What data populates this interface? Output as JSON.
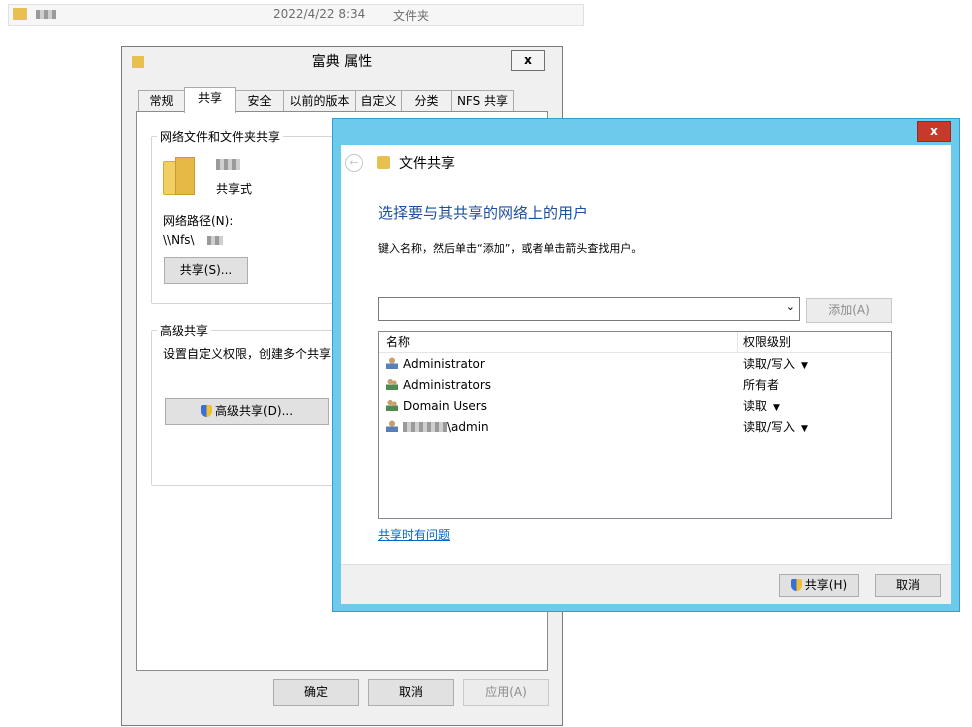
{
  "explorer": {
    "date": "2022/4/22 8:34",
    "type": "文件夹",
    "icon": "folder-icon"
  },
  "properties": {
    "title": "富典 属性",
    "close_label": "x",
    "tabs": [
      {
        "label": "常规"
      },
      {
        "label": "共享",
        "active": true
      },
      {
        "label": "安全"
      },
      {
        "label": "以前的版本"
      },
      {
        "label": "自定义"
      },
      {
        "label": "分类"
      },
      {
        "label": "NFS 共享"
      }
    ],
    "network_share": {
      "group_title": "网络文件和文件夹共享",
      "share_type": "共享式",
      "path_label": "网络路径(N):",
      "path_value": "\\\\Nfs\\",
      "share_button": "共享(S)..."
    },
    "advanced": {
      "group_title": "高级共享",
      "description": "设置自定义权限，创建多个共享",
      "button": "高级共享(D)..."
    },
    "footer": {
      "ok": "确定",
      "cancel": "取消",
      "apply": "应用(A)"
    }
  },
  "wizard": {
    "title": "文件共享",
    "close_label": "x",
    "heading": "选择要与其共享的网络上的用户",
    "instruction": "键入名称，然后单击“添加”，或者单击箭头查找用户。",
    "input_value": "",
    "add_button": "添加(A)",
    "columns": {
      "name": "名称",
      "permission": "权限级别"
    },
    "rows": [
      {
        "name": "Administrator",
        "permission": "读取/写入",
        "dropdown": true,
        "icon": "user-icon"
      },
      {
        "name": "Administrators",
        "permission": "所有者",
        "dropdown": false,
        "icon": "group-icon"
      },
      {
        "name": "Domain Users",
        "permission": "读取",
        "dropdown": true,
        "icon": "group-icon"
      },
      {
        "name": "\\admin",
        "permission": "读取/写入",
        "dropdown": true,
        "icon": "user-icon"
      }
    ],
    "help_link": "共享时有问题",
    "share_button": "共享(H)",
    "cancel_button": "取消",
    "colors": {
      "frame": "#6ccbec",
      "heading": "#1e4fa0",
      "link": "#0066cc",
      "close": "#c7392b"
    }
  }
}
